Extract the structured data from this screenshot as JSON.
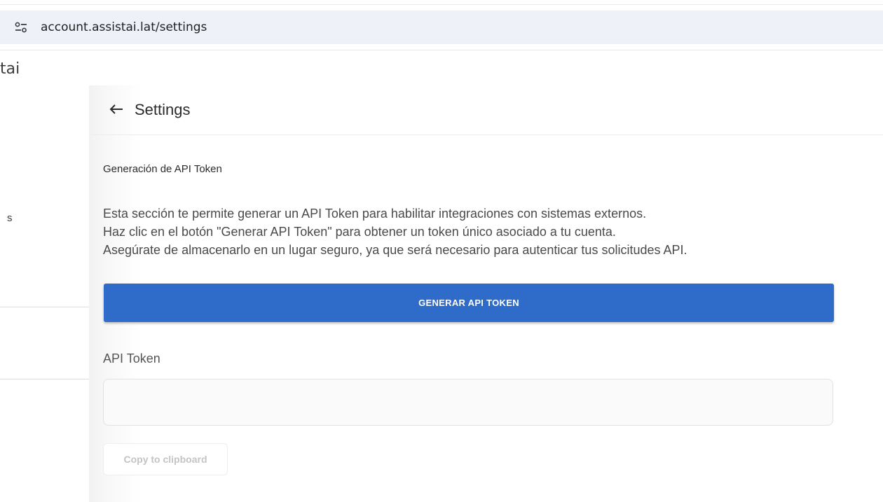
{
  "browser": {
    "url": "account.assistai.lat/settings",
    "site_info_icon": "tune-icon"
  },
  "background_app": {
    "brand_fragment": "tai",
    "sidebar_fragment": "s"
  },
  "panel": {
    "back_icon": "arrow-left-icon",
    "title": "Settings",
    "section_title": "Generación de API Token",
    "description": [
      "Esta sección te permite generar un API Token para habilitar integraciones con sistemas externos.",
      "Haz clic en el botón \"Generar API Token\" para obtener un token único asociado a tu cuenta.",
      "Asegúrate de almacenarlo en un lugar seguro, ya que será necesario para autenticar tus solicitudes API."
    ],
    "generate_button_label": "GENERAR API TOKEN",
    "token_field_label": "API Token",
    "token_field_value": "",
    "copy_button_label": "Copy to clipboard"
  },
  "colors": {
    "primary_button": "#2f6cc9",
    "address_bar_bg": "#eef1f8"
  }
}
